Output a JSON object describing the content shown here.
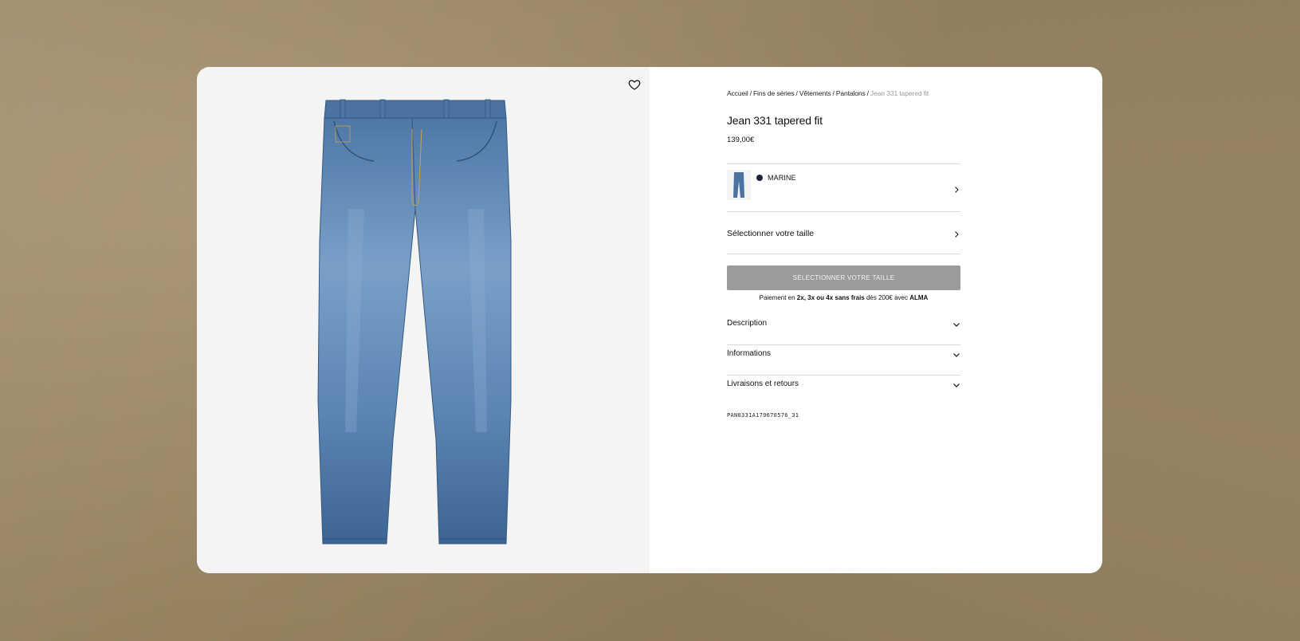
{
  "breadcrumb": {
    "items": [
      "Accueil",
      "Fins de séries",
      "Vêtements",
      "Pantalons"
    ],
    "separator": "/",
    "current": "Jean 331 tapered fit"
  },
  "product": {
    "title": "Jean 331 tapered fit",
    "price": "139,00€",
    "sku": "PAN0331A179670576_31"
  },
  "color": {
    "label": "MARINE",
    "swatch": "#1c2336"
  },
  "size": {
    "label": "Sélectionner votre taille"
  },
  "cta": {
    "label": "SÉLECTIONNER VOTRE TAILLE",
    "bg": "#9b9b9b"
  },
  "payment": {
    "prefix": "Paiement en ",
    "bold_terms": "2x, 3x ou 4x sans frais",
    "middle": " dès 200€ avec ",
    "provider": "ALMA"
  },
  "accordions": [
    {
      "label": "Description"
    },
    {
      "label": "Informations"
    },
    {
      "label": "Livraisons et retours"
    }
  ],
  "icons": {
    "favorite": "heart-icon",
    "chevron_right": "chevron-right-icon",
    "chevron_down": "chevron-down-icon"
  },
  "colors": {
    "denim": "#4a77a8",
    "card_bg": "#ffffff",
    "media_bg": "#f4f4f4"
  }
}
